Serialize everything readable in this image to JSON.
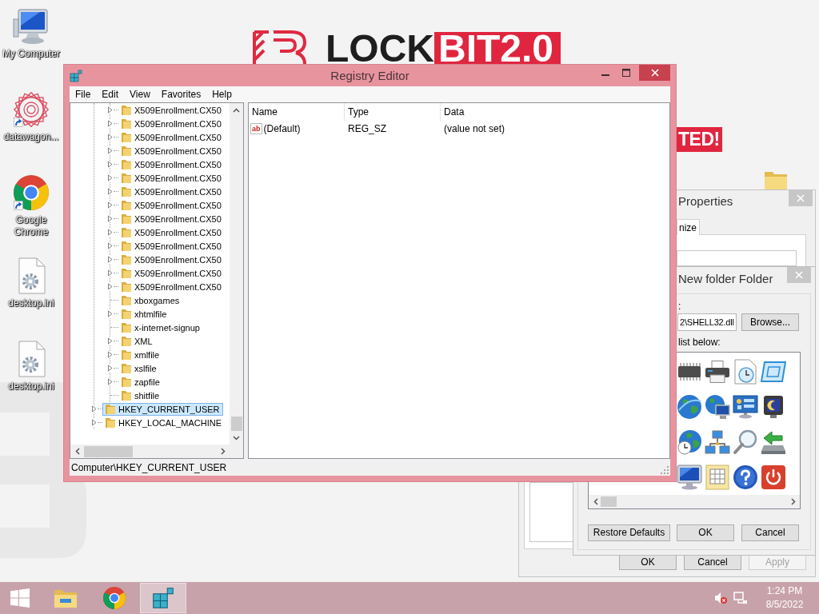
{
  "wallpaper": {
    "brand_dark": "LOCK",
    "brand_light": "BIT2.0",
    "banner": "TED!"
  },
  "desktop_icons": [
    {
      "label": "My Computer",
      "kind": "computer",
      "shortcut": false
    },
    {
      "label": "datawagon...",
      "kind": "app",
      "shortcut": true
    },
    {
      "label": "Google Chrome",
      "kind": "browser",
      "shortcut": true
    },
    {
      "label": "desktop.ini",
      "kind": "settings_file",
      "shortcut": false
    },
    {
      "label": "desktop.ini",
      "kind": "settings_file",
      "shortcut": false
    }
  ],
  "properties_dialog": {
    "title": "Properties",
    "tabs": [
      {
        "label": "nize",
        "selected": true
      }
    ],
    "buttons": [
      {
        "label": "OK",
        "disabled": false
      },
      {
        "label": "Cancel",
        "disabled": false
      },
      {
        "label": "Apply",
        "disabled": true
      }
    ]
  },
  "change_icon_dialog": {
    "title": "New folder Folder",
    "file_label": ":",
    "file_path": "2\\SHELL32.dll",
    "browse_button": "Browse...",
    "list_label": "list below:",
    "buttons": [
      "Restore Defaults",
      "OK",
      "Cancel"
    ]
  },
  "registry_editor": {
    "title": "Registry Editor",
    "menu": [
      "File",
      "Edit",
      "View",
      "Favorites",
      "Help"
    ],
    "tree": {
      "continued_subkeys": [
        {
          "label": "X509Enrollment.CX50",
          "expandable": true,
          "selected": false
        },
        {
          "label": "X509Enrollment.CX50",
          "expandable": true,
          "selected": false
        },
        {
          "label": "X509Enrollment.CX50",
          "expandable": true,
          "selected": false
        },
        {
          "label": "X509Enrollment.CX50",
          "expandable": true,
          "selected": false
        },
        {
          "label": "X509Enrollment.CX50",
          "expandable": true,
          "selected": false
        },
        {
          "label": "X509Enrollment.CX50",
          "expandable": true,
          "selected": false
        },
        {
          "label": "X509Enrollment.CX50",
          "expandable": true,
          "selected": false
        },
        {
          "label": "X509Enrollment.CX50",
          "expandable": true,
          "selected": false
        },
        {
          "label": "X509Enrollment.CX50",
          "expandable": true,
          "selected": false
        },
        {
          "label": "X509Enrollment.CX50",
          "expandable": true,
          "selected": false
        },
        {
          "label": "X509Enrollment.CX50",
          "expandable": true,
          "selected": false
        },
        {
          "label": "X509Enrollment.CX50",
          "expandable": true,
          "selected": false
        },
        {
          "label": "X509Enrollment.CX50",
          "expandable": true,
          "selected": false
        },
        {
          "label": "X509Enrollment.CX50",
          "expandable": true,
          "selected": false
        },
        {
          "label": "xboxgames",
          "expandable": false,
          "selected": false
        },
        {
          "label": "xhtmlfile",
          "expandable": true,
          "selected": false
        },
        {
          "label": "x-internet-signup",
          "expandable": false,
          "selected": false
        },
        {
          "label": "XML",
          "expandable": true,
          "selected": false
        },
        {
          "label": "xmlfile",
          "expandable": true,
          "selected": false
        },
        {
          "label": "xslfile",
          "expandable": true,
          "selected": false
        },
        {
          "label": "zapfile",
          "expandable": true,
          "selected": false
        },
        {
          "label": "shitfile",
          "expandable": false,
          "selected": false
        }
      ],
      "root_keys": [
        {
          "label": "HKEY_CURRENT_USER",
          "expandable": true,
          "selected": true
        },
        {
          "label": "HKEY_LOCAL_MACHINE",
          "expandable": true,
          "selected": false
        }
      ]
    },
    "columns": [
      "Name",
      "Type",
      "Data"
    ],
    "values": [
      {
        "icon_text": "ab",
        "name": "(Default)",
        "type": "REG_SZ",
        "data": "(value not set)"
      }
    ],
    "status_bar": "Computer\\HKEY_CURRENT_USER"
  },
  "taskbar": {
    "apps": [
      {
        "kind": "explorer",
        "active": false
      },
      {
        "kind": "browser",
        "active": false
      },
      {
        "kind": "registry",
        "active": true
      }
    ],
    "time": "1:24 PM",
    "date": "8/5/2022"
  }
}
